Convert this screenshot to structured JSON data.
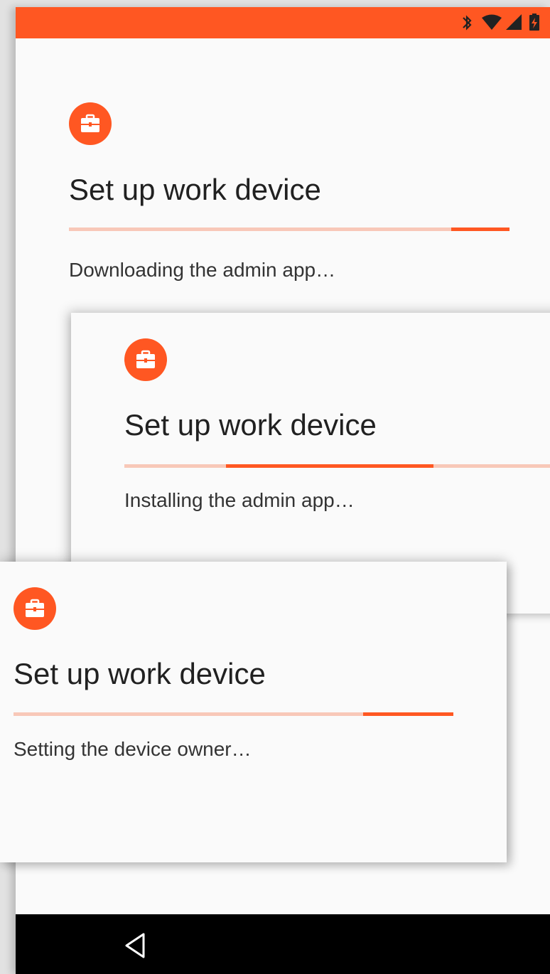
{
  "colors": {
    "accent": "#ff5722",
    "progress_track": "#f8c8b8"
  },
  "status_bar": {
    "icons": [
      "bluetooth-icon",
      "wifi-icon",
      "cell-signal-icon",
      "battery-charging-icon"
    ]
  },
  "screens": [
    {
      "icon": "briefcase-icon",
      "title": "Set up work device",
      "status": "Downloading the admin app…"
    },
    {
      "icon": "briefcase-icon",
      "title": "Set up work device",
      "status": "Installing the admin app…"
    },
    {
      "icon": "briefcase-icon",
      "title": "Set up work device",
      "status": "Setting the device owner…"
    }
  ],
  "nav_bar": {
    "icons": [
      "back-icon"
    ]
  }
}
